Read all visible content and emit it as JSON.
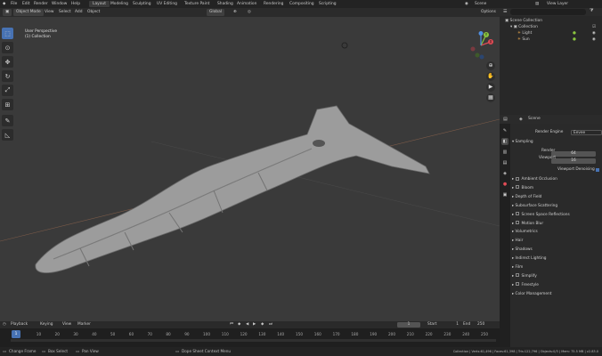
{
  "menu": [
    "File",
    "Edit",
    "Render",
    "Window",
    "Help"
  ],
  "workspaces": [
    "Layout",
    "Modeling",
    "Sculpting",
    "UV Editing",
    "Texture Paint",
    "Shading",
    "Animation",
    "Rendering",
    "Compositing",
    "Scripting"
  ],
  "scene_name": "Scene",
  "view_layer": "View Layer",
  "viewport": {
    "mode": "Object Mode",
    "menus": [
      "View",
      "Select",
      "Add",
      "Object"
    ],
    "transform": "Global",
    "label_line1": "User Perspective",
    "label_line2": "(1) Collection",
    "options": "Options"
  },
  "outliner": {
    "scene_collection": "Scene Collection",
    "items": [
      "Collection",
      "Light",
      "Sun"
    ]
  },
  "properties": {
    "title": "Scene",
    "render_engine_label": "Render Engine",
    "render_engine_value": "Eevee",
    "sampling": "Sampling",
    "render_label": "Render",
    "render_value": "64",
    "viewport_label": "Viewport",
    "viewport_value": "16",
    "denoising": "Viewport Denoising",
    "panels": [
      {
        "label": "Ambient Occlusion",
        "check": true
      },
      {
        "label": "Bloom",
        "check": true
      },
      {
        "label": "Depth of Field",
        "check": false
      },
      {
        "label": "Subsurface Scattering",
        "check": false
      },
      {
        "label": "Screen Space Reflections",
        "check": true
      },
      {
        "label": "Motion Blur",
        "check": true
      },
      {
        "label": "Volumetrics",
        "check": false
      },
      {
        "label": "Hair",
        "check": false
      },
      {
        "label": "Shadows",
        "check": false
      },
      {
        "label": "Indirect Lighting",
        "check": false
      },
      {
        "label": "Film",
        "check": false
      },
      {
        "label": "Simplify",
        "check": true
      },
      {
        "label": "Freestyle",
        "check": true
      },
      {
        "label": "Color Management",
        "check": false
      }
    ]
  },
  "timeline": {
    "menus": [
      "Playback",
      "Keying",
      "View",
      "Marker"
    ],
    "current_frame": "1",
    "start_label": "Start",
    "start_value": "1",
    "end_label": "End",
    "end_value": "250",
    "ticks": [
      "0",
      "10",
      "20",
      "30",
      "40",
      "50",
      "60",
      "70",
      "80",
      "90",
      "100",
      "110",
      "120",
      "130",
      "140",
      "150",
      "160",
      "170",
      "180",
      "190",
      "200",
      "210",
      "220",
      "230",
      "240",
      "250"
    ]
  },
  "status": {
    "left1": "Change Frame",
    "left2": "Box Select",
    "left3": "Pan View",
    "center": "Dope Sheet Context Menu",
    "right": "Collection | Verts:61,496 | Faces:61,398 | Tris:122,796 | Objects:0/3 | Mem: 75.5 MB | v2.83.0"
  },
  "colors": {
    "accent": "#4772b3",
    "viewport_bg": "#3a3a3a",
    "panel_bg": "#2a2a2a",
    "x_axis": "#e04b55",
    "y_axis": "#8bc53f",
    "z_axis": "#4f8fe0"
  }
}
